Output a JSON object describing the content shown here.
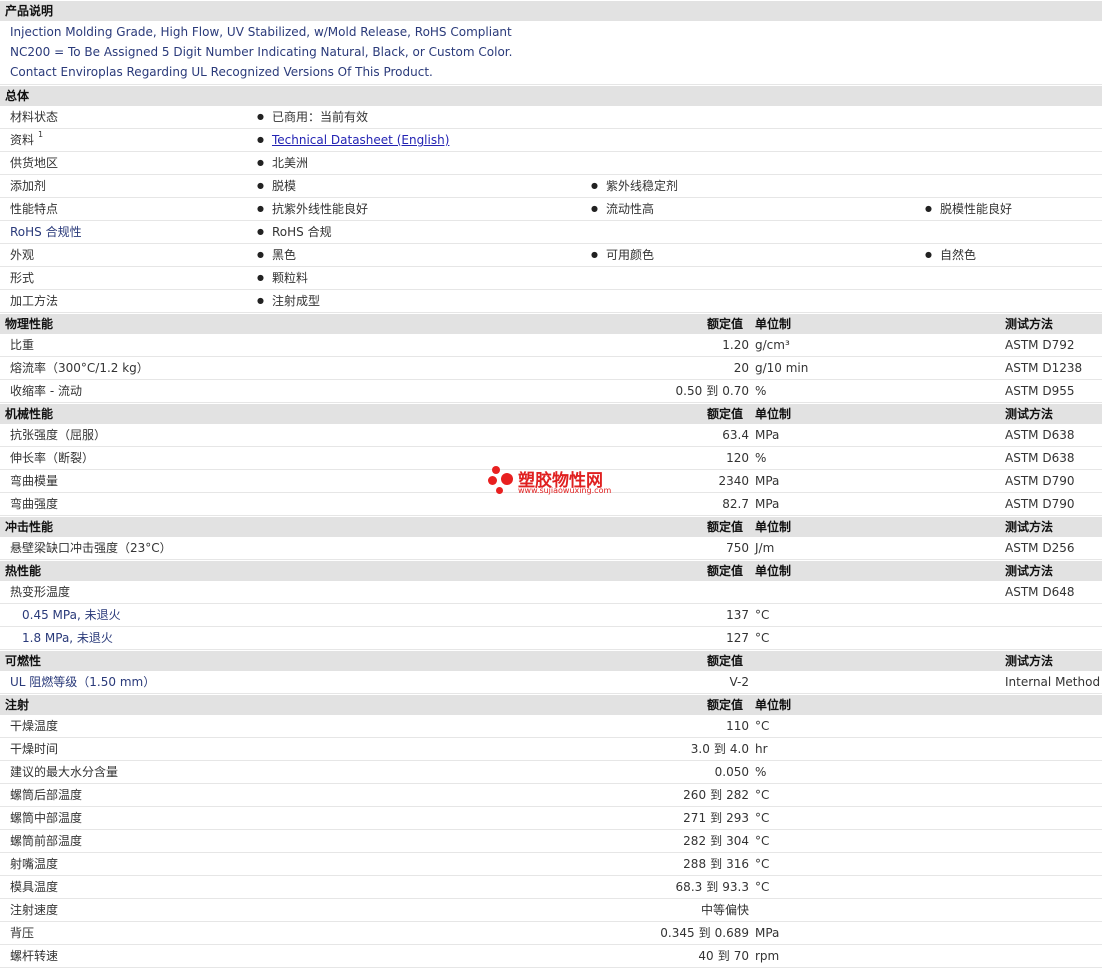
{
  "desc": {
    "title": "产品说明",
    "lines": [
      "Injection Molding Grade, High Flow, UV Stabilized, w/Mold Release, RoHS Compliant",
      "NC200 = To Be Assigned 5 Digit Number Indicating Natural, Black, or Custom Color.",
      "Contact Enviroplas Regarding UL Recognized Versions Of This Product."
    ]
  },
  "general": {
    "title": "总体",
    "rows": [
      {
        "label": "材料状态",
        "items": [
          "已商用：当前有效"
        ]
      },
      {
        "label": "资料",
        "sup": "1",
        "items": [
          "Technical Datasheet (English)"
        ]
      },
      {
        "label": "供货地区",
        "items": [
          "北美洲"
        ]
      },
      {
        "label": "添加剂",
        "items": [
          "脱模",
          "紫外线稳定剂"
        ]
      },
      {
        "label": "性能特点",
        "items": [
          "抗紫外线性能良好",
          "流动性高",
          "脱模性能良好"
        ]
      },
      {
        "label": "RoHS 合规性",
        "items": [
          "RoHS 合规"
        ]
      },
      {
        "label": "外观",
        "items": [
          "黑色",
          "可用颜色",
          "自然色"
        ]
      },
      {
        "label": "形式",
        "items": [
          "颗粒料"
        ]
      },
      {
        "label": "加工方法",
        "items": [
          "注射成型"
        ]
      }
    ]
  },
  "headers": {
    "rated": "额定值",
    "unit": "单位制",
    "test": "测试方法",
    "to": "到"
  },
  "physical": {
    "title": "物理性能",
    "rows": [
      {
        "label": "比重",
        "val": "1.20",
        "unit": "g/cm³",
        "test": "ASTM D792"
      },
      {
        "label": "熔流率（300°C/1.2 kg）",
        "val": "20",
        "unit": "g/10 min",
        "test": "ASTM D1238"
      },
      {
        "label": "收缩率 - 流动",
        "lo": "0.50",
        "hi": "0.70",
        "unit": "%",
        "test": "ASTM D955"
      }
    ]
  },
  "mechanical": {
    "title": "机械性能",
    "rows": [
      {
        "label": "抗张强度（屈服）",
        "val": "63.4",
        "unit": "MPa",
        "test": "ASTM D638"
      },
      {
        "label": "伸长率（断裂）",
        "val": "120",
        "unit": "%",
        "test": "ASTM D638"
      },
      {
        "label": "弯曲模量",
        "val": "2340",
        "unit": "MPa",
        "test": "ASTM D790"
      },
      {
        "label": "弯曲强度",
        "val": "82.7",
        "unit": "MPa",
        "test": "ASTM D790"
      }
    ]
  },
  "impact": {
    "title": "冲击性能",
    "rows": [
      {
        "label": "悬壁梁缺口冲击强度（23°C）",
        "val": "750",
        "unit": "J/m",
        "test": "ASTM D256"
      }
    ]
  },
  "thermal": {
    "title": "热性能",
    "rows": [
      {
        "label": "热变形温度",
        "val": "",
        "unit": "",
        "test": "ASTM D648"
      },
      {
        "label": "0.45 MPa, 未退火",
        "indent": true,
        "val": "137",
        "unit": "°C",
        "test": ""
      },
      {
        "label": "1.8 MPa, 未退火",
        "indent": true,
        "val": "127",
        "unit": "°C",
        "test": ""
      }
    ]
  },
  "flammability": {
    "title": "可燃性",
    "rows": [
      {
        "label": "UL 阻燃等级（1.50 mm）",
        "val": "V-2",
        "unit": "",
        "test": "Internal Method"
      }
    ]
  },
  "injection": {
    "title": "注射",
    "rows": [
      {
        "label": "干燥温度",
        "val": "110",
        "unit": "°C"
      },
      {
        "label": "干燥时间",
        "lo": "3.0",
        "hi": "4.0",
        "unit": "hr"
      },
      {
        "label": "建议的最大水分含量",
        "val": "0.050",
        "unit": "%"
      },
      {
        "label": "螺筒后部温度",
        "lo": "260",
        "hi": "282",
        "unit": "°C"
      },
      {
        "label": "螺筒中部温度",
        "lo": "271",
        "hi": "293",
        "unit": "°C"
      },
      {
        "label": "螺筒前部温度",
        "lo": "282",
        "hi": "304",
        "unit": "°C"
      },
      {
        "label": "射嘴温度",
        "lo": "288",
        "hi": "316",
        "unit": "°C"
      },
      {
        "label": "模具温度",
        "lo": "68.3",
        "hi": "93.3",
        "unit": "°C"
      },
      {
        "label": "注射速度",
        "val": "中等偏快",
        "unit": ""
      },
      {
        "label": "背压",
        "lo": "0.345",
        "hi": "0.689",
        "unit": "MPa"
      },
      {
        "label": "螺杆转速",
        "lo": "40",
        "hi": "70",
        "unit": "rpm"
      }
    ]
  },
  "watermark": {
    "title": "塑胶物性网",
    "url": "www.sujiaowuxing.com"
  }
}
